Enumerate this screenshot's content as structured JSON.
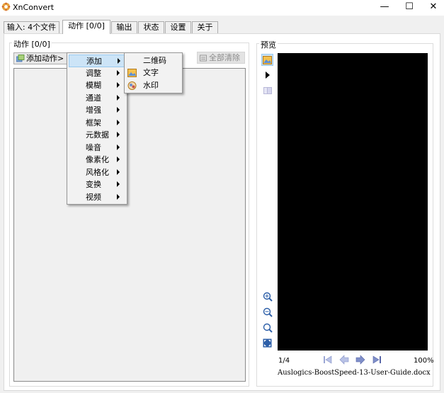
{
  "window": {
    "title": "XnConvert",
    "minimize_glyph": "—",
    "maximize_glyph": "☐",
    "close_glyph": "✕",
    "app_icon": "xnconvert-gear-icon"
  },
  "tabs": [
    {
      "label": "输入: 4个文件",
      "active": false
    },
    {
      "label": "动作 [0/0]",
      "active": true
    },
    {
      "label": "输出",
      "active": false
    },
    {
      "label": "状态",
      "active": false
    },
    {
      "label": "设置",
      "active": false
    },
    {
      "label": "关于",
      "active": false
    }
  ],
  "actions": {
    "group_title": "动作 [0/0]",
    "add_button_label": "添加动作>",
    "clear_button_label": "全部清除"
  },
  "menu": {
    "items": [
      {
        "label": "添加",
        "highlighted": true
      },
      {
        "label": "调整"
      },
      {
        "label": "模糊"
      },
      {
        "label": "通道"
      },
      {
        "label": "增强"
      },
      {
        "label": "框架"
      },
      {
        "label": "元数据"
      },
      {
        "label": "噪音"
      },
      {
        "label": "像素化"
      },
      {
        "label": "风格化"
      },
      {
        "label": "变换"
      },
      {
        "label": "视频"
      }
    ],
    "submenu": [
      {
        "label": "二维码",
        "icon": ""
      },
      {
        "label": "文字",
        "icon": "text-image-icon"
      },
      {
        "label": "水印",
        "icon": "watermark-icon"
      }
    ]
  },
  "preview": {
    "group_title": "预览",
    "page_counter": "1/4",
    "zoom": "100%",
    "filename": "Auslogics-BoostSpeed-13-User-Guide.docx",
    "canvas_color": "#000000"
  },
  "colors": {
    "highlight_bg": "#cce4f7",
    "highlight_border": "#99c9ef",
    "nav_arrow": "#7f8fc9"
  }
}
